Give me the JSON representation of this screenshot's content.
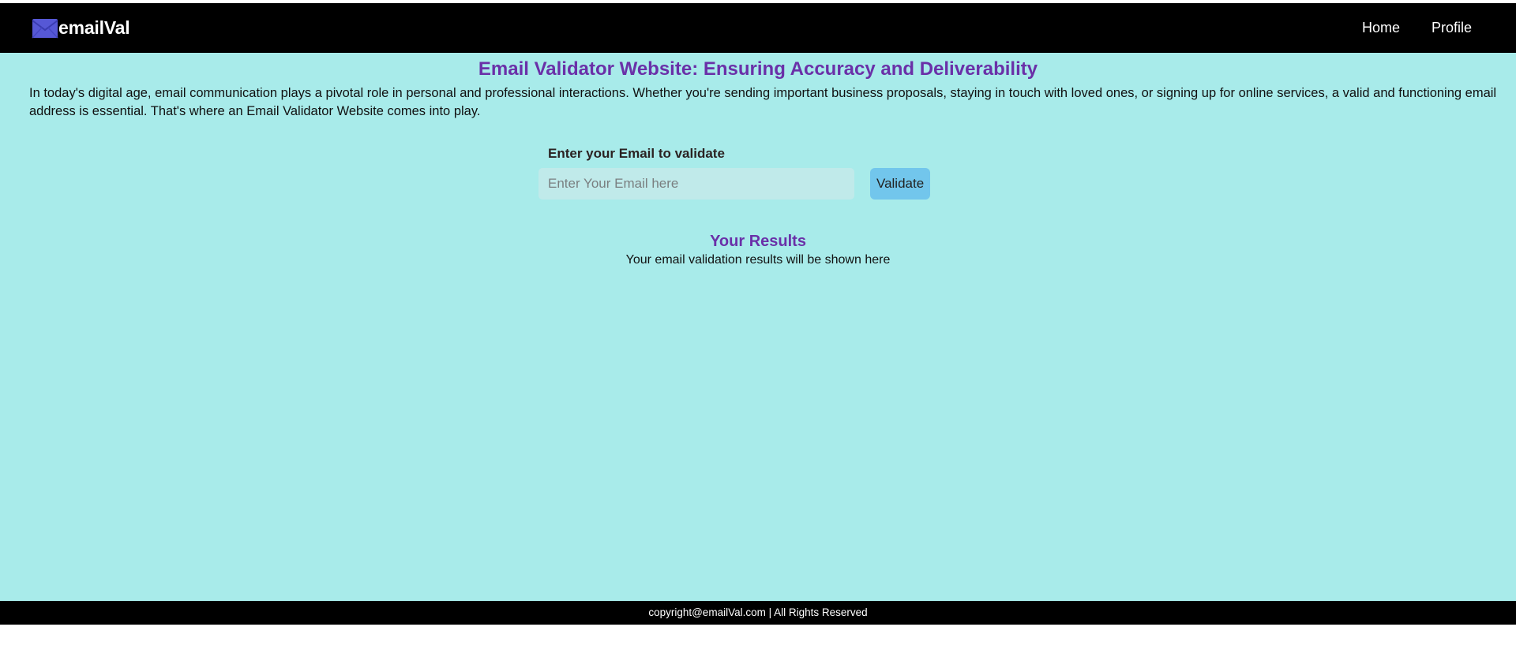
{
  "header": {
    "brand_name": "emailVal",
    "logo_icon": "envelope-icon",
    "nav": [
      {
        "label": "Home"
      },
      {
        "label": "Profile"
      }
    ]
  },
  "main": {
    "title": "Email Validator Website: Ensuring Accuracy and Deliverability",
    "intro": "In today's digital age, email communication plays a pivotal role in personal and professional interactions. Whether you're sending important business proposals, staying in touch with loved ones, or signing up for online services, a valid and functioning email address is essential. That's where an Email Validator Website comes into play.",
    "form": {
      "label": "Enter your Email to validate",
      "input_value": "",
      "input_placeholder": "Enter Your Email here",
      "button_label": "Validate"
    },
    "results": {
      "heading": "Your Results",
      "message": "Your email validation results will be shown here"
    }
  },
  "footer": {
    "text": "copyright@emailVal.com | All Rights Reserved"
  },
  "colors": {
    "header_bg": "#000000",
    "main_bg": "#a8ebea",
    "accent_purple": "#6a30a8",
    "button_bg": "#72c6ec",
    "input_bg": "#c0eaea"
  }
}
